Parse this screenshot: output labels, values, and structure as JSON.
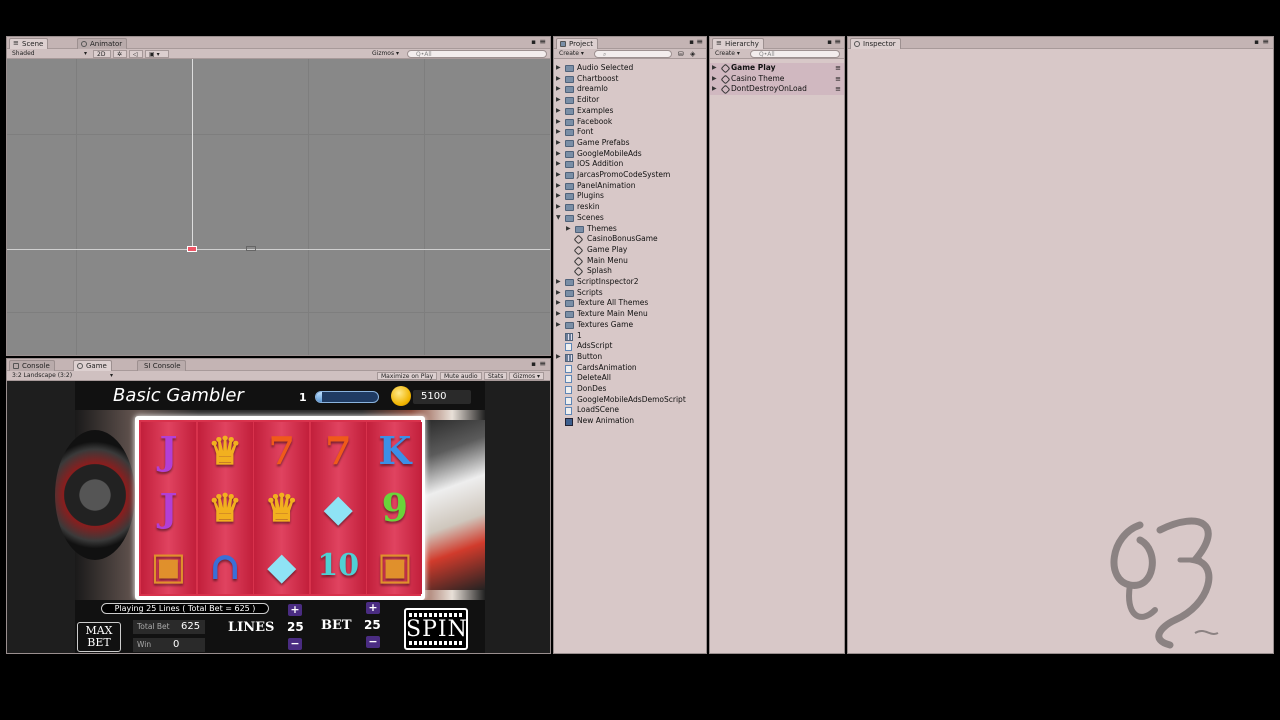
{
  "scene_panel": {
    "tabs": [
      {
        "label": "Scene"
      },
      {
        "label": "Animator"
      }
    ],
    "shading": "Shaded",
    "mode_2d": "2D",
    "gizmos": "Gizmos",
    "search_placeholder": "Q•All"
  },
  "game_panel": {
    "tabs": [
      {
        "label": "Console"
      },
      {
        "label": "Game"
      },
      {
        "label": "SI Console"
      }
    ],
    "aspect": "3:2 Landscape (3:2)",
    "maximize": "Maximize on Play",
    "mute": "Mute audio",
    "stats": "Stats",
    "gizmos": "Gizmos"
  },
  "game": {
    "title": "Basic Gambler",
    "level": "1",
    "xp_fraction": 0.1,
    "coins": "5100",
    "playing_text": "Playing 25 Lines ( Total Bet = 625 )",
    "max_bet_line1": "MAX",
    "max_bet_line2": "BET",
    "total_bet_label": "Total Bet",
    "total_bet_value": "625",
    "win_label": "Win",
    "win_value": "0",
    "lines_label": "LINES",
    "lines_value": "25",
    "bet_label": "BET",
    "bet_value": "25",
    "plus": "+",
    "minus": "−",
    "spin_label": "SPIN",
    "reels": [
      [
        {
          "s": "J",
          "c": "#b23fd6"
        },
        {
          "s": "J",
          "c": "#b23fd6"
        },
        {
          "s": "▣",
          "c": "#e0902c"
        }
      ],
      [
        {
          "s": "♛",
          "c": "#f2b01f"
        },
        {
          "s": "♛",
          "c": "#f2b01f"
        },
        {
          "s": "∩",
          "c": "#3a6fd8"
        }
      ],
      [
        {
          "s": "7",
          "c": "#f05a1a"
        },
        {
          "s": "♛",
          "c": "#f2b01f"
        },
        {
          "s": "◆",
          "c": "#8fe3f5"
        }
      ],
      [
        {
          "s": "7",
          "c": "#f05a1a"
        },
        {
          "s": "◆",
          "c": "#8fe3f5"
        },
        {
          "s": "10",
          "c": "#4fd0d4"
        }
      ],
      [
        {
          "s": "K",
          "c": "#3c8fe6"
        },
        {
          "s": "9",
          "c": "#6ad43a"
        },
        {
          "s": "▣",
          "c": "#e0902c"
        }
      ]
    ]
  },
  "project_panel": {
    "tab": "Project",
    "create": "Create",
    "items": [
      {
        "label": "Audio Selected",
        "type": "folder",
        "indent": 0,
        "arrow": "▶"
      },
      {
        "label": "Chartboost",
        "type": "folder",
        "indent": 0,
        "arrow": "▶"
      },
      {
        "label": "dreamlo",
        "type": "folder",
        "indent": 0,
        "arrow": "▶"
      },
      {
        "label": "Editor",
        "type": "folder",
        "indent": 0,
        "arrow": "▶"
      },
      {
        "label": "Examples",
        "type": "folder",
        "indent": 0,
        "arrow": "▶"
      },
      {
        "label": "Facebook",
        "type": "folder",
        "indent": 0,
        "arrow": "▶"
      },
      {
        "label": "Font",
        "type": "folder",
        "indent": 0,
        "arrow": "▶"
      },
      {
        "label": "Game Prefabs",
        "type": "folder",
        "indent": 0,
        "arrow": "▶"
      },
      {
        "label": "GoogleMobileAds",
        "type": "folder",
        "indent": 0,
        "arrow": "▶"
      },
      {
        "label": "IOS Addition",
        "type": "folder",
        "indent": 0,
        "arrow": "▶"
      },
      {
        "label": "JarcasPromoCodeSystem",
        "type": "folder",
        "indent": 0,
        "arrow": "▶"
      },
      {
        "label": "PanelAnimation",
        "type": "folder",
        "indent": 0,
        "arrow": "▶"
      },
      {
        "label": "Plugins",
        "type": "folder",
        "indent": 0,
        "arrow": "▶"
      },
      {
        "label": "reskin",
        "type": "folder",
        "indent": 0,
        "arrow": "▶"
      },
      {
        "label": "Scenes",
        "type": "folder",
        "indent": 0,
        "arrow": "▼"
      },
      {
        "label": "Themes",
        "type": "folder",
        "indent": 1,
        "arrow": "▶"
      },
      {
        "label": "CasinoBonusGame",
        "type": "scene",
        "indent": 1,
        "arrow": ""
      },
      {
        "label": "Game Play",
        "type": "scene",
        "indent": 1,
        "arrow": ""
      },
      {
        "label": "Main Menu",
        "type": "scene",
        "indent": 1,
        "arrow": ""
      },
      {
        "label": "Splash",
        "type": "scene",
        "indent": 1,
        "arrow": ""
      },
      {
        "label": "ScriptInspector2",
        "type": "folder",
        "indent": 0,
        "arrow": "▶"
      },
      {
        "label": "Scripts",
        "type": "folder",
        "indent": 0,
        "arrow": "▶"
      },
      {
        "label": "Texture All Themes",
        "type": "folder",
        "indent": 0,
        "arrow": "▶"
      },
      {
        "label": "Texture Main Menu",
        "type": "folder",
        "indent": 0,
        "arrow": "▶"
      },
      {
        "label": "Textures Game",
        "type": "folder",
        "indent": 0,
        "arrow": "▶"
      },
      {
        "label": "1",
        "type": "grid",
        "indent": 0,
        "arrow": ""
      },
      {
        "label": "AdsScript",
        "type": "script",
        "indent": 0,
        "arrow": ""
      },
      {
        "label": "Button",
        "type": "grid",
        "indent": 0,
        "arrow": "▶"
      },
      {
        "label": "CardsAnimation",
        "type": "script",
        "indent": 0,
        "arrow": ""
      },
      {
        "label": "DeleteAll",
        "type": "script",
        "indent": 0,
        "arrow": ""
      },
      {
        "label": "DonDes",
        "type": "script",
        "indent": 0,
        "arrow": ""
      },
      {
        "label": "GoogleMobileAdsDemoScript",
        "type": "script",
        "indent": 0,
        "arrow": ""
      },
      {
        "label": "LoadSCene",
        "type": "script",
        "indent": 0,
        "arrow": ""
      },
      {
        "label": "New Animation",
        "type": "anim",
        "indent": 0,
        "arrow": ""
      }
    ]
  },
  "hierarchy_panel": {
    "tab": "Hierarchy",
    "create": "Create",
    "search_placeholder": "Q•All",
    "items": [
      {
        "label": "Game Play",
        "bold": true
      },
      {
        "label": "Casino Theme",
        "bold": false
      },
      {
        "label": "DontDestroyOnLoad",
        "bold": false
      }
    ]
  },
  "inspector_panel": {
    "tab": "Inspector"
  }
}
